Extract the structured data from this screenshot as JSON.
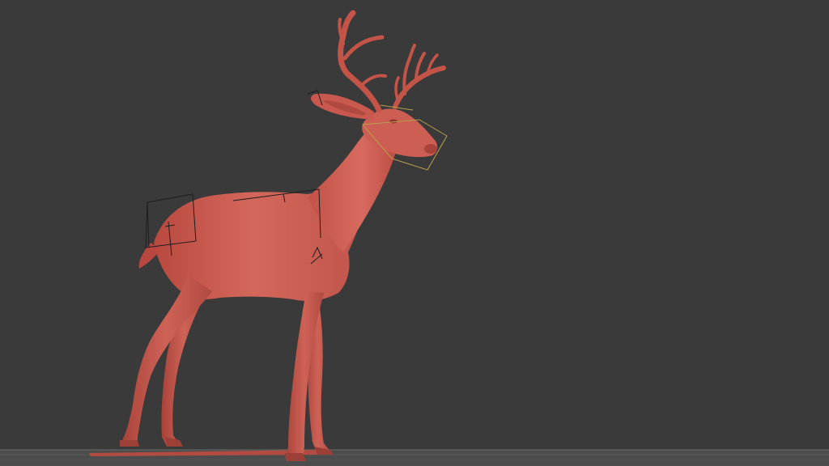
{
  "viewport": {
    "background": "#3a3a3a",
    "floor_color": "#545454",
    "floor_line_color": "#6a6a6a"
  },
  "model": {
    "subject": "deer-sculpt",
    "body_color": "#c8554a",
    "shadow_color": "#9c3f37",
    "highlight_color": "#d9685c",
    "cage_color": "#1e1e1e",
    "selected_cage_color": "#b8a14a"
  }
}
